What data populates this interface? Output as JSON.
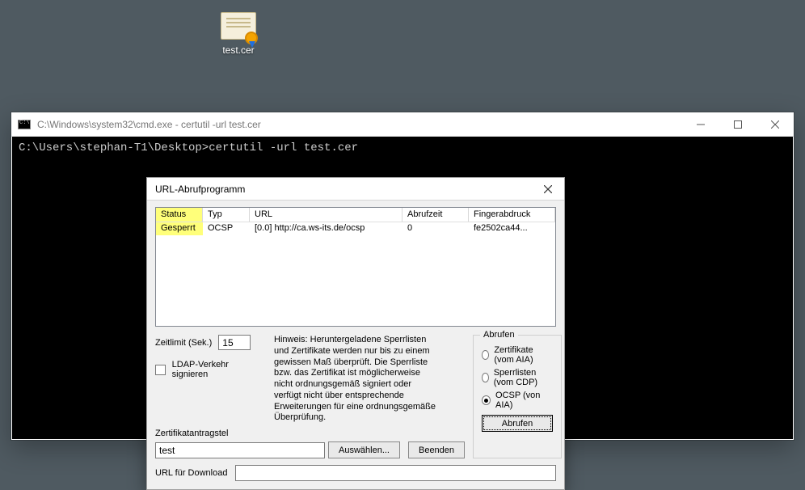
{
  "desktop": {
    "file_label": "test.cer"
  },
  "cmd": {
    "title": "C:\\Windows\\system32\\cmd.exe - certutil  -url test.cer",
    "line1": "C:\\Users\\stephan-T1\\Desktop>certutil -url test.cer"
  },
  "dialog": {
    "title": "URL-Abrufprogramm",
    "columns": {
      "status": "Status",
      "typ": "Typ",
      "url": "URL",
      "time": "Abrufzeit",
      "fp": "Fingerabdruck"
    },
    "row": {
      "status": "Gesperrt",
      "typ": "OCSP",
      "url": "[0.0] http://ca.ws-its.de/ocsp",
      "time": "0",
      "fp": "fe2502ca44..."
    },
    "timelimit_label": "Zeitlimit (Sek.)",
    "timelimit_value": "15",
    "ldap_label": "LDAP-Verkehr signieren",
    "hint": "Hinweis: Heruntergeladene Sperrlisten und Zertifikate werden nur bis zu einem gewissen Maß überprüft. Die Sperrliste bzw. das Zertifikat ist möglicherweise nicht ordnungsgemäß signiert oder verfügt nicht über entsprechende Erweiterungen für eine ordnungsgemäße Überprüfung.",
    "cert_template_label": "Zertifikatantragstel",
    "cert_template_value": "test",
    "select_btn": "Auswählen...",
    "end_btn": "Beenden",
    "group": {
      "legend": "Abrufen",
      "opt_aia": "Zertifikate (vom AIA)",
      "opt_cdp": "Sperrlisten (vom CDP)",
      "opt_ocsp": "OCSP (von AIA)",
      "fetch_btn": "Abrufen"
    },
    "url_label": "URL für Download"
  }
}
